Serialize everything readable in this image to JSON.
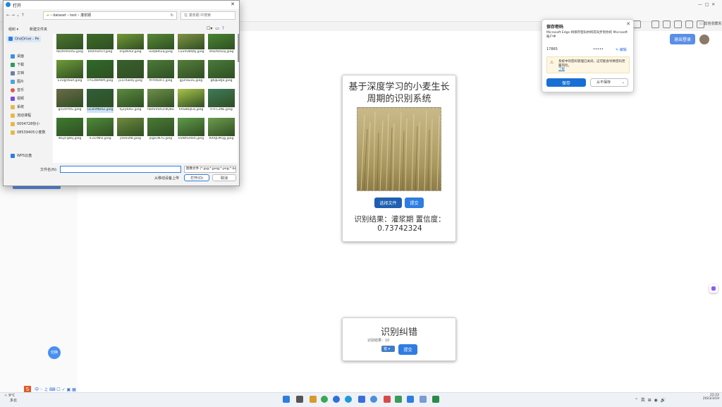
{
  "dialog": {
    "title": "打开",
    "breadcrumb": [
      "dataset",
      "test",
      "灌浆期"
    ],
    "search_placeholder": "在 灌浆期 中搜索",
    "organize_label": "组织",
    "new_folder_label": "新建文件夹",
    "nav_items": [
      {
        "label": "OneDrive - Pe",
        "icon": "cloud-icon"
      },
      {
        "label": "桌面",
        "icon": "desktop-icon"
      },
      {
        "label": "下载",
        "icon": "download-icon"
      },
      {
        "label": "文档",
        "icon": "document-icon"
      },
      {
        "label": "图片",
        "icon": "picture-icon"
      },
      {
        "label": "音乐",
        "icon": "music-icon"
      },
      {
        "label": "视频",
        "icon": "video-icon"
      },
      {
        "label": "系统",
        "icon": "folder-icon"
      },
      {
        "label": "流动课程",
        "icon": "folder-icon"
      },
      {
        "label": "0004728份小",
        "icon": "folder-icon"
      },
      {
        "label": "08539405小麦数",
        "icon": "folder-icon"
      },
      {
        "label": "WPS云盘",
        "icon": "cloud-icon"
      }
    ],
    "files": [
      "lbDXmhxAu.jpeg",
      "bXzmeA1Y.jpeg",
      "e5plKAuI.jpeg",
      "ouQBdlZq.jpeg",
      "CuuVD8Q6j.jpeg",
      "dHZADGaj.jpeg",
      "E1UgV6aA.jpeg",
      "nYx3WAKM.jpeg",
      "jL1cXw4Q.jpeg",
      "fhYR6dF1.jpeg",
      "gJ3rsw3G.jpeg",
      "gKqE8IJa.jpeg",
      "gnuVrtXG.jpeg",
      "Gs3lnMBXZ.jpeg",
      "hjZy6XEi.jpeg",
      "hbmnhOGF8Q8vq.jpeg",
      "hAS8bqCb.jpeg",
      "hTFC2NE.jpeg",
      "iKGJFq8ej.jpeg",
      "iF21rNhz.jpeg",
      "jlOeLVt8.jpeg",
      "jkgxvN7u.jpeg",
      "kSNXSmkR.jpeg",
      "KXRJLMcgj.jpeg"
    ],
    "file_colors": [
      "#4f7a32",
      "#3f6e2c",
      "#7aa23a",
      "#5c8f3a",
      "#8a9a4a",
      "#4d8a36",
      "#6f9a3a",
      "#2f6a2a",
      "#3a5f2f",
      "#4d7a38",
      "#567d3b",
      "#4a7a3a",
      "#6b6a4a",
      "#2f5f3a",
      "#5a8a3f",
      "#6f8f4a",
      "#a9c34a",
      "#3f7a5a",
      "#3f7a2f",
      "#4f8a3a",
      "#6f8a3f",
      "#4a7a36",
      "#5f9a4a",
      "#6f9a4f"
    ],
    "filename_label": "文件名(N):",
    "filename_value": "",
    "filetype_value": "图像文件 (*.jpg;*.jpeg;*.png;*.bmp)",
    "from_mobile_label": "从移动设备上传",
    "open_label": "打开(O)",
    "cancel_label": "取消"
  },
  "main_card": {
    "title": "基于深度学习的小麦生长周期的识别系统",
    "choose_file_label": "选择文件",
    "submit_label": "提交",
    "result_text": "识别结果：灌浆期 置信度：0.73742324"
  },
  "correction_card": {
    "title": "识别纠错",
    "hint_label": "识别结果：10",
    "select_value": "错",
    "submit_label": "提交"
  },
  "popup": {
    "title": "保存密码",
    "description": "Microsoft Edge 将保存密码并将其同步到你的 Microsoft 账户中",
    "username": "17865",
    "password": "•••••",
    "edit_label": "编辑",
    "warning_text": "系统中的密码管理已关闭，这可能会导致密码泄露风险。",
    "warning_link": "了解",
    "save_label": "保存",
    "never_label": "从不保存"
  },
  "page": {
    "login_button": "退出登录",
    "left_button": "",
    "floating_button": "切换"
  },
  "taskbar": {
    "weather": "9°C",
    "weather_sub": "多云",
    "time": "22:22",
    "date": "2023/3/19"
  },
  "colors": {
    "primary_blue": "#2f7de1",
    "dark_blue": "#1f5fb0",
    "save_blue": "#1a6fd4"
  }
}
